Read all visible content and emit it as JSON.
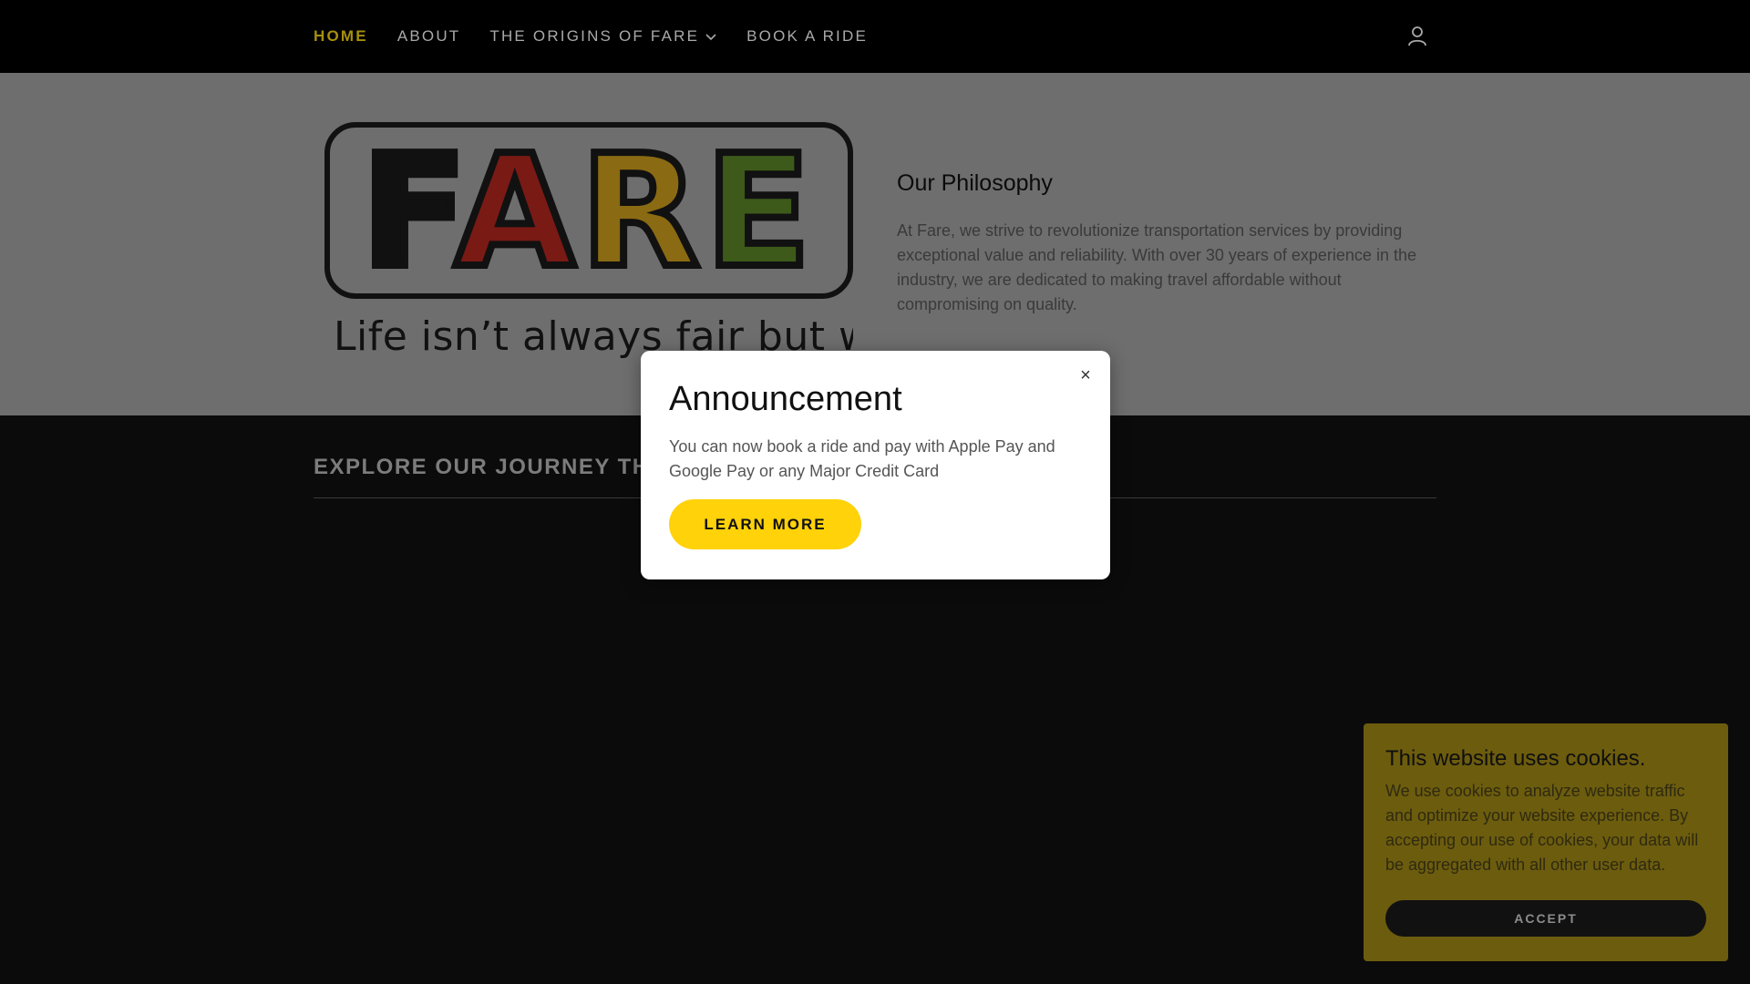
{
  "nav": {
    "items": [
      {
        "label": "HOME"
      },
      {
        "label": "ABOUT"
      },
      {
        "label": "THE ORIGINS OF FARE"
      },
      {
        "label": "BOOK A RIDE"
      }
    ],
    "user_icon": "user-icon"
  },
  "hero": {
    "logo": {
      "letters": [
        "F",
        "A",
        "R",
        "E"
      ],
      "tagline": "Life isn’t always fair but we are"
    },
    "philosophy_title": "Our Philosophy",
    "philosophy_text": "At Fare, we strive to revolutionize transportation services by providing exceptional value and reliability. With over 30 years of experience in the industry, we are dedicated to making travel affordable without compromising on quality."
  },
  "journey": {
    "title": "EXPLORE OUR JOURNEY TH"
  },
  "modal": {
    "close_icon": "close-icon",
    "title": "Announcement",
    "text": "You can now book a ride and pay with Apple Pay and Google Pay or any Major Credit Card",
    "button_label": "LEARN MORE"
  },
  "cookie": {
    "title": "This website uses cookies.",
    "text": "We use cookies to analyze website traffic and optimize your website experience. By accepting our use of cookies, your data will be aggregated with all other user data.",
    "button_label": "ACCEPT"
  },
  "colors": {
    "accent": "#ffd20a",
    "nav_active": "#a58f0e"
  }
}
